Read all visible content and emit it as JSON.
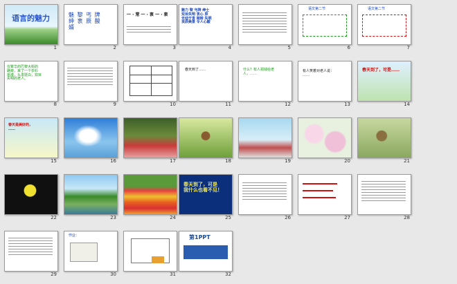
{
  "slides": [
    {
      "n": "1",
      "title": "语言的魅力"
    },
    {
      "n": "2",
      "text": "魅 黎 丐 牌\n绅 衷 辰 酸\n婿"
    },
    {
      "n": "3",
      "text": "一 · 常 一 · 衷 一 · 衷"
    },
    {
      "n": "4",
      "text": "魅力 黎 丐牌 绅士\n双目失明 衷心 辰\n无动于衷 婉转 失明\n良辰美景 令人心酸"
    },
    {
      "n": "5"
    },
    {
      "n": "6",
      "text": "语文第二节"
    },
    {
      "n": "7",
      "text": "语文第二节"
    },
    {
      "n": "8",
      "text": "在繁华的巴黎大街的\n路旁，来了一个衣衫\n褴褛，头发斑白，双目\n失明的老人。"
    },
    {
      "n": "9"
    },
    {
      "n": "10"
    },
    {
      "n": "11",
      "text": "春天到了……"
    },
    {
      "n": "12",
      "text": "什么？有人捐钱给老\n人，……"
    },
    {
      "n": "13",
      "text": "有人笑着对老人说：\n……"
    },
    {
      "n": "14",
      "text": "春天到了，可是……"
    },
    {
      "n": "15",
      "text": "春天是美好的，\n……"
    },
    {
      "n": "16"
    },
    {
      "n": "17"
    },
    {
      "n": "18"
    },
    {
      "n": "19"
    },
    {
      "n": "20"
    },
    {
      "n": "21"
    },
    {
      "n": "22"
    },
    {
      "n": "23"
    },
    {
      "n": "24"
    },
    {
      "n": "25",
      "text": "春天到了，可是\n我什么也看不见！"
    },
    {
      "n": "26"
    },
    {
      "n": "27"
    },
    {
      "n": "28"
    },
    {
      "n": "29"
    },
    {
      "n": "30",
      "text": "作业："
    },
    {
      "n": "31"
    },
    {
      "n": "32",
      "text": "第1PPT"
    }
  ],
  "colors": {
    "background": "#e8e8e8",
    "title_blue": "#2b56c8",
    "green_text": "#1a9a1a",
    "red_text": "#d01010"
  }
}
